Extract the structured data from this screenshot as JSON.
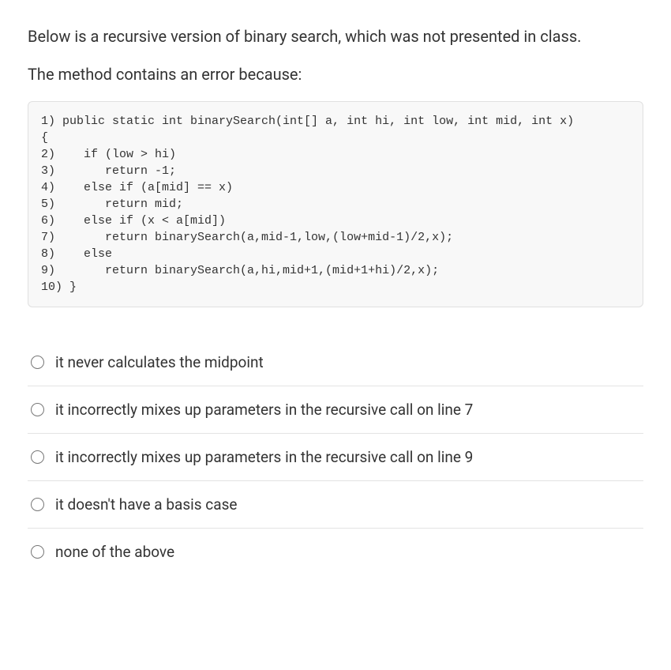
{
  "question": {
    "paragraph1": "Below is a recursive version of binary search, which was not presented in class.",
    "paragraph2": "The method contains an error because:"
  },
  "code": "1) public static int binarySearch(int[] a, int hi, int low, int mid, int x)\n{\n2)    if (low > hi)\n3)       return -1;\n4)    else if (a[mid] == x)\n5)       return mid;\n6)    else if (x < a[mid])\n7)       return binarySearch(a,mid-1,low,(low+mid-1)/2,x);\n8)    else\n9)       return binarySearch(a,hi,mid+1,(mid+1+hi)/2,x);\n10) }",
  "options": [
    {
      "label": "it never calculates the midpoint"
    },
    {
      "label": "it incorrectly mixes up parameters in the recursive call on line 7"
    },
    {
      "label": "it incorrectly mixes up parameters in the recursive call on line 9"
    },
    {
      "label": "it doesn't have a basis case"
    },
    {
      "label": "none of the above"
    }
  ]
}
